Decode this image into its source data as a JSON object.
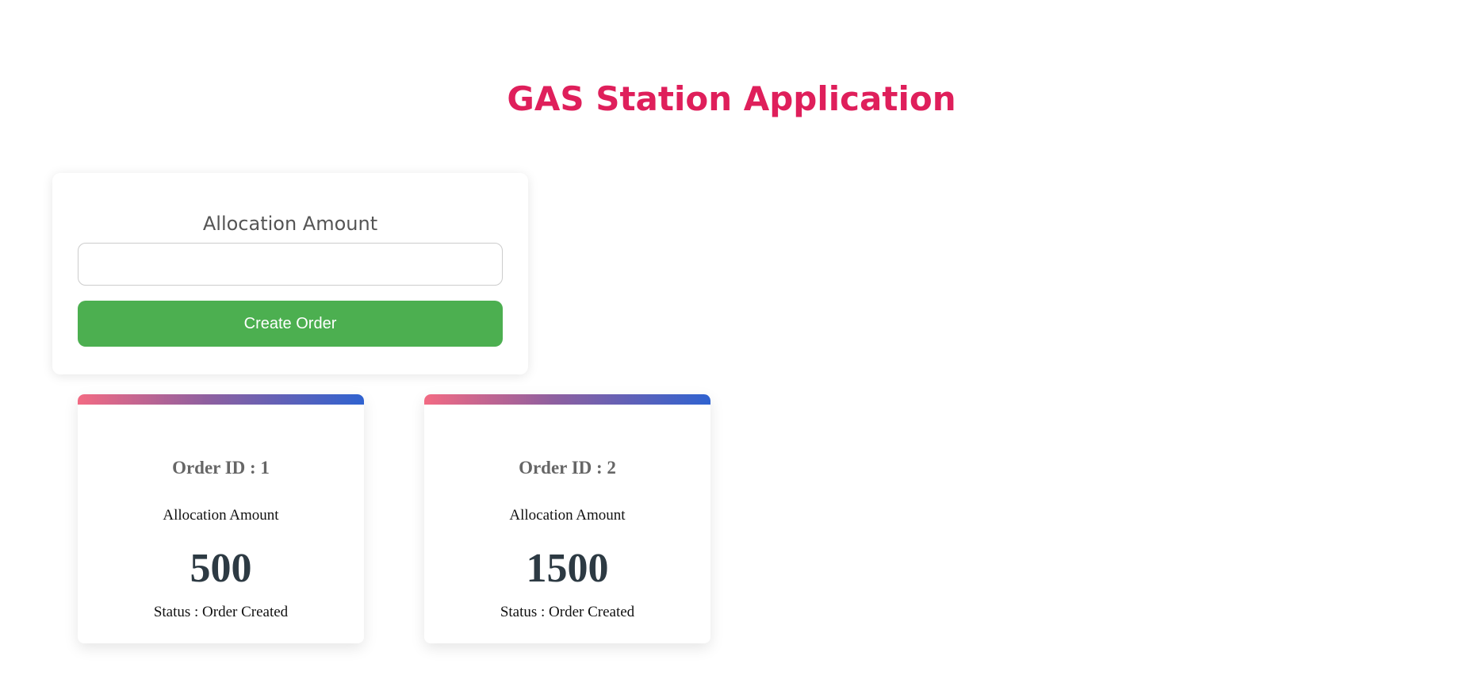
{
  "header": {
    "title": "GAS Station Application"
  },
  "form": {
    "label": "Allocation Amount",
    "input_value": "",
    "input_placeholder": "",
    "button_label": "Create Order"
  },
  "orders": [
    {
      "id_text": "Order ID : 1",
      "amount_label": "Allocation Amount",
      "amount": "500",
      "status_text": "Status : Order Created"
    },
    {
      "id_text": "Order ID : 2",
      "amount_label": "Allocation Amount",
      "amount": "1500",
      "status_text": "Status : Order Created"
    }
  ],
  "colors": {
    "title": "#df1f5b",
    "button": "#4caf50",
    "accent_start": "#f26a83",
    "accent_end": "#2f62d0"
  }
}
